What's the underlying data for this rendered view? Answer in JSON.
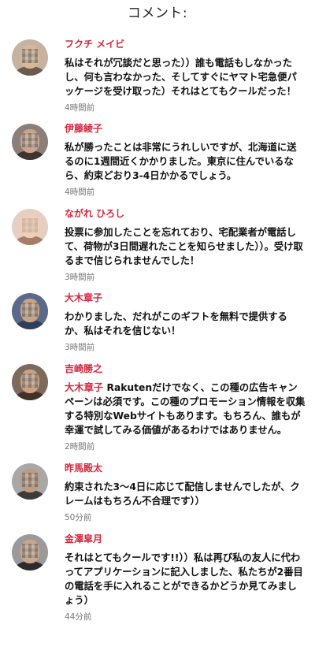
{
  "header": {
    "title": "コメント:"
  },
  "comments": [
    {
      "name": "フクチ メイビ",
      "text": "私はそれが冗談だと思った））誰も電話もしなかったし、何も言わなかった、そしてすぐにヤマト宅急便パッケージを受け取った）それはとてもクールだった！",
      "time": "4時間前"
    },
    {
      "name": "伊藤綾子",
      "text": "私が勝ったことは非常にうれしいですが、北海道に送るのに1週間近くかかりました。東京に住んでいるなら、約束どおり3-4日かかるでしょう。",
      "time": "4時間前"
    },
    {
      "name": "ながれ ひろし",
      "text": "投票に参加したことを忘れており、宅配業者が電話して、荷物が3日間遅れたことを知らせました））。受け取るまで信じられませんでした！",
      "time": "3時間前"
    },
    {
      "name": "大木章子",
      "text": "わかりました、だれがこのギフトを無料で提供するか、私はそれを信じない！",
      "time": "3時間前"
    },
    {
      "name": "吉崎勝之",
      "mention": "大木章子",
      "text": " Rakutenだけでなく、この種の広告キャンペーンは必須です。この種のプロモーション情報を収集する特別なWebサイトもあります。もちろん、誰もが幸運で試してみる価値があるわけではありません。",
      "time": "2時間前"
    },
    {
      "name": "昨馬殿太",
      "text": "約束された3〜4日に応じて配信しませんでしたが、クレームはもちろん不合理です））",
      "time": "50分前"
    },
    {
      "name": "金澤皐月",
      "text": "それはとてもクールです!!））私は再び私の友人に代わってアプリケーションに記入しました、私たちが2番目の電話を手に入れることができるかどうか見てみましょう）",
      "time": "44分前"
    }
  ],
  "colors": {
    "name": "#d7263d",
    "text": "#111111",
    "time": "#777777"
  }
}
